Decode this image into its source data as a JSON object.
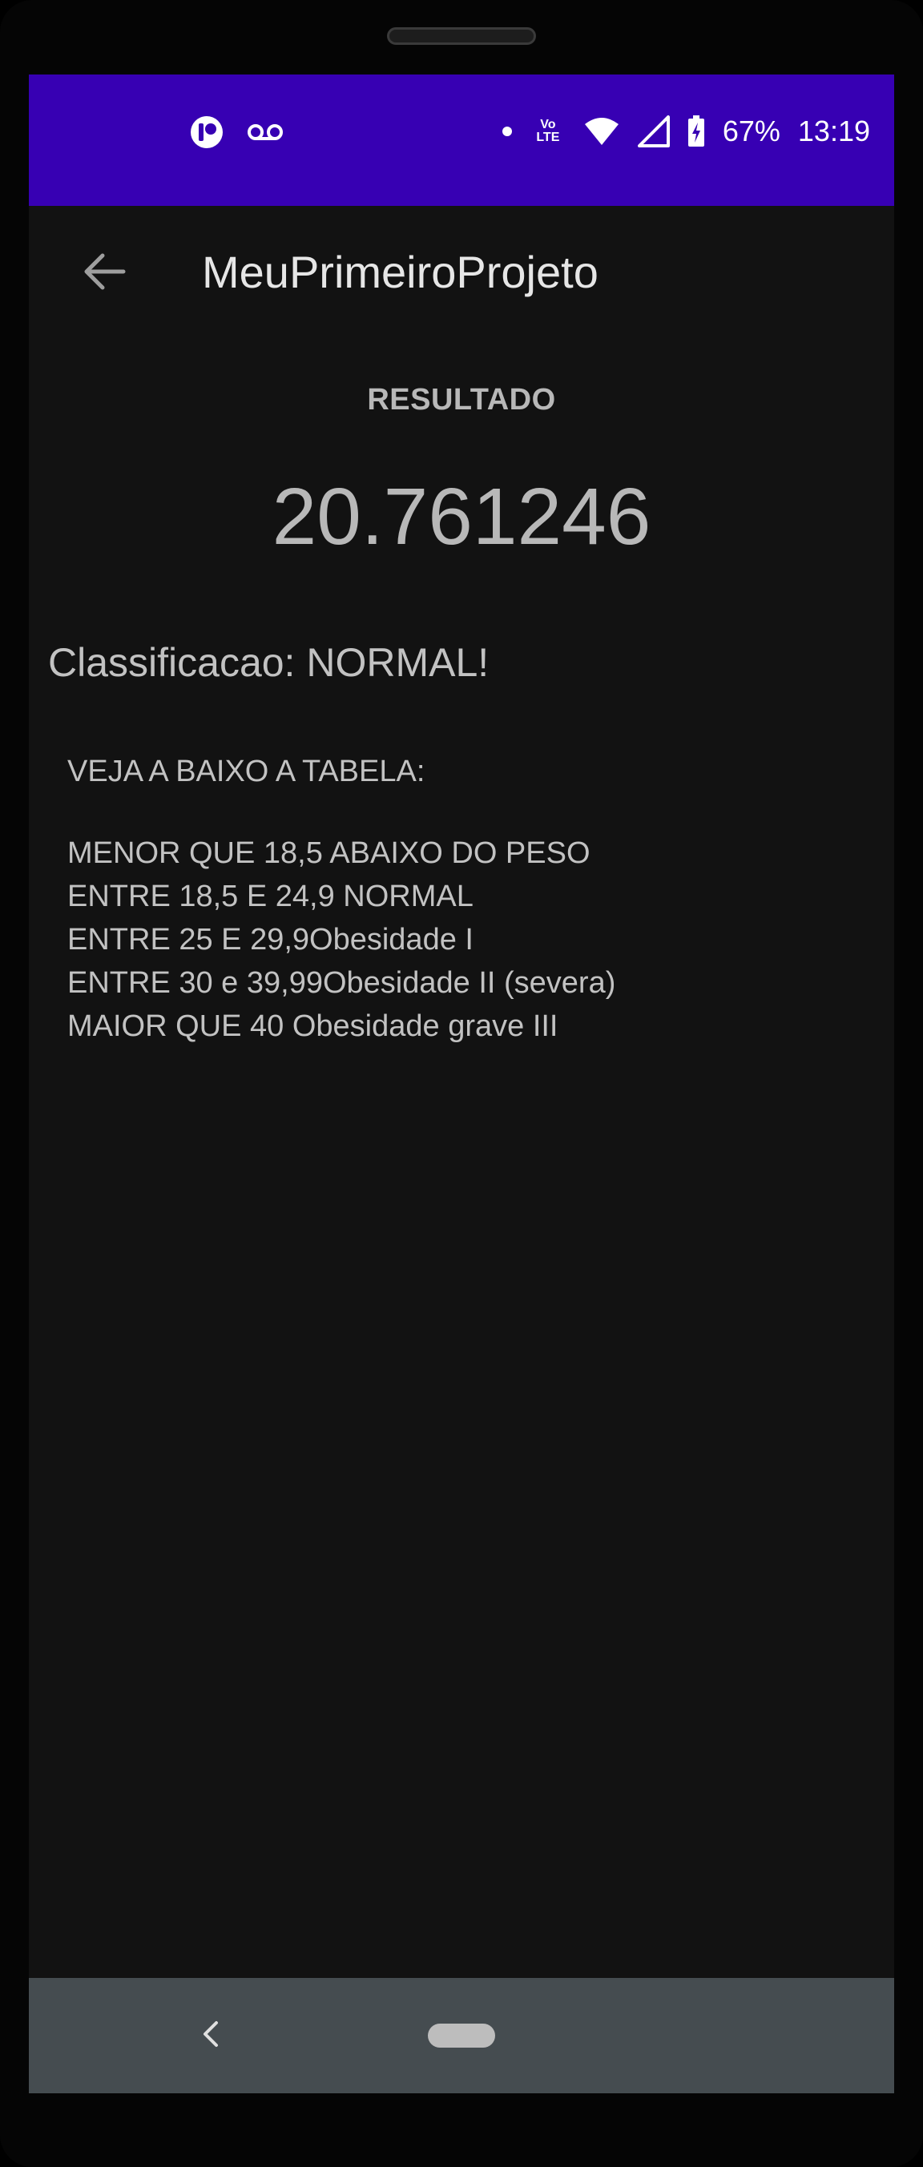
{
  "status_bar": {
    "battery": "67%",
    "time": "13:19",
    "network_label": "Vo LTE",
    "icons": [
      "app-notification-icon",
      "voicemail-icon",
      "dot-icon",
      "volte-icon",
      "wifi-icon",
      "cell-signal-icon",
      "battery-charging-icon"
    ],
    "background": "#3700b3"
  },
  "app_bar": {
    "title": "MeuPrimeiroProjeto",
    "back_icon": "arrow-back-icon"
  },
  "result": {
    "label": "RESULTADO",
    "value": "20.761246"
  },
  "classification": "Classificacao: NORMAL!",
  "table": {
    "heading": "VEJA A BAIXO A TABELA:",
    "rows": [
      "MENOR QUE 18,5 ABAIXO DO PESO",
      "ENTRE 18,5 E 24,9 NORMAL",
      "ENTRE 25 E 29,9Obesidade I",
      "ENTRE 30 e 39,99Obesidade II (severa)",
      "MAIOR QUE 40 Obesidade grave III"
    ]
  },
  "nav_bar": {
    "back_icon": "nav-back-icon",
    "home_icon": "nav-home-pill"
  },
  "colors": {
    "screen_background": "#121212",
    "nav_bar": "#454c50",
    "text": "#c2c2c2"
  }
}
